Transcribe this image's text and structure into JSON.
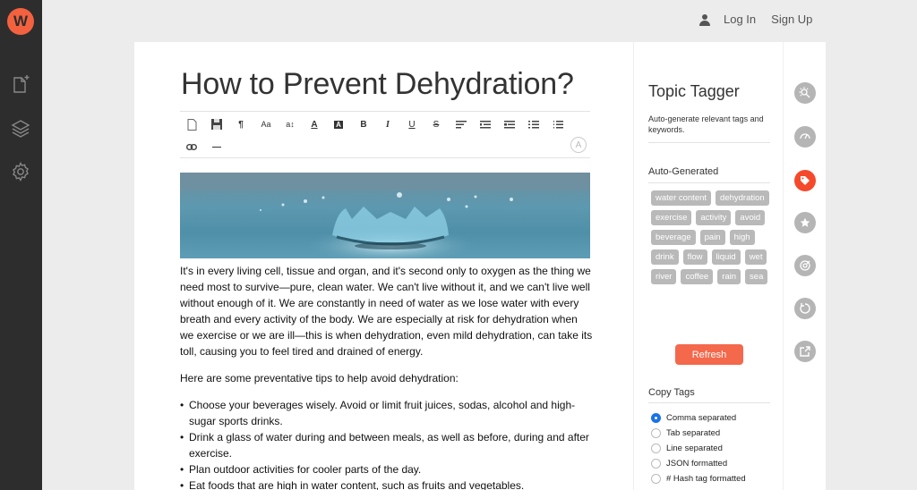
{
  "app": {
    "logo_letter": "W"
  },
  "sidebar": {
    "items": [
      {
        "name": "new-document",
        "icon": "new-document-icon"
      },
      {
        "name": "layers",
        "icon": "layers-icon"
      },
      {
        "name": "settings",
        "icon": "gear-icon"
      }
    ]
  },
  "header": {
    "login_label": "Log In",
    "signup_label": "Sign Up",
    "user_icon": "user-icon"
  },
  "editor": {
    "title": "How to Prevent Dehydration?",
    "toolbar": {
      "row1": [
        "new-file",
        "save",
        "paragraph",
        "font-size",
        "line-height",
        "font-color",
        "background-color",
        "bold",
        "italic",
        "underline",
        "strikethrough",
        "align-left",
        "indent",
        "outdent",
        "unordered-list",
        "ordered-list"
      ],
      "row2": [
        "link",
        "horizontal-rule"
      ],
      "glyphs": {
        "paragraph": "¶",
        "font-size": "Aa",
        "line-height": "a↕",
        "font-color": "A",
        "background-color": "A",
        "bold": "B",
        "italic": "I",
        "underline": "U",
        "strikethrough": "S",
        "horizontal-rule": "—",
        "auto": "A"
      }
    },
    "image_alt": "Water droplet splash",
    "paragraphs": [
      "It's in every living cell, tissue and organ, and it's second only to oxygen as the thing we need most to survive—pure, clean water. We can't live without it, and we can't live well without enough of it. We are constantly in need of water as we lose water with every breath and every activity of the body. We are especially at risk for dehydration when we exercise or we are ill—this is when dehydration, even mild dehydration, can take its toll, causing you to feel tired and drained of energy.",
      "Here are some preventative tips to help avoid dehydration:"
    ],
    "tips": [
      "Choose your beverages wisely. Avoid or limit fruit juices, sodas, alcohol and high-sugar sports drinks.",
      "Drink a glass of water during and between meals, as well as before, during and after exercise.",
      "Plan outdoor activities for cooler parts of the day.",
      "Eat foods that are high in water content, such as fruits and vegetables."
    ]
  },
  "tagger": {
    "title": "Topic Tagger",
    "description": "Auto-generate relevant tags and keywords.",
    "auto_label": "Auto-Generated",
    "tags": [
      "water content",
      "dehydration",
      "exercise",
      "activity",
      "avoid",
      "beverage",
      "pain",
      "high",
      "drink",
      "flow",
      "liquid",
      "wet",
      "river",
      "coffee",
      "rain",
      "sea"
    ],
    "refresh_label": "Refresh",
    "copy_label": "Copy Tags",
    "copy_options": [
      {
        "label": "Comma separated",
        "checked": true
      },
      {
        "label": "Tab separated",
        "checked": false
      },
      {
        "label": "Line separated",
        "checked": false
      },
      {
        "label": "JSON formatted",
        "checked": false
      },
      {
        "label": "# Hash tag formatted",
        "checked": false
      }
    ]
  },
  "tools": [
    {
      "name": "seo-analyzer",
      "icon": "sun-search-icon",
      "active": false
    },
    {
      "name": "readability",
      "icon": "gauge-icon",
      "active": false
    },
    {
      "name": "topic-tagger",
      "icon": "tag-icon",
      "active": true
    },
    {
      "name": "favorites",
      "icon": "star-icon",
      "active": false
    },
    {
      "name": "target",
      "icon": "target-icon",
      "active": false
    },
    {
      "name": "history",
      "icon": "history-icon",
      "active": false
    },
    {
      "name": "export",
      "icon": "export-icon",
      "active": false
    }
  ],
  "colors": {
    "accent": "#f4613f",
    "active_tool": "#f44a2b",
    "tag_bg": "#b9b9b9",
    "radio_checked": "#1a73e8"
  }
}
